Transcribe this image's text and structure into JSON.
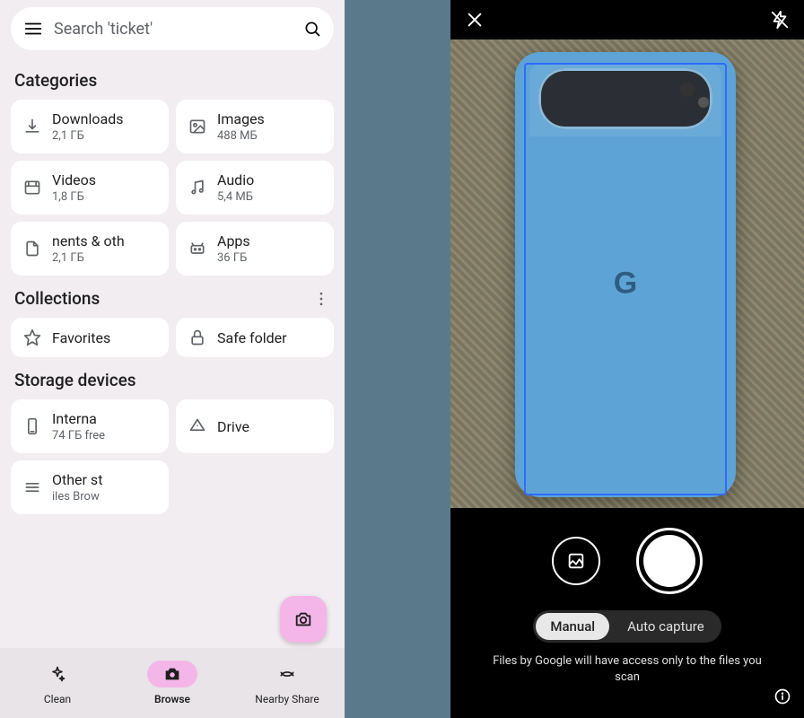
{
  "left": {
    "search": {
      "placeholder": "Search 'ticket'"
    },
    "sections": {
      "categories_title": "Categories",
      "collections_title": "Collections",
      "storage_title": "Storage devices"
    },
    "categories": [
      {
        "label": "Downloads",
        "sub": "2,1 ГБ",
        "icon": "download-icon"
      },
      {
        "label": "Images",
        "sub": "488 МБ",
        "icon": "image-icon"
      },
      {
        "label": "Videos",
        "sub": "1,8 ГБ",
        "icon": "film-icon"
      },
      {
        "label": "Audio",
        "sub": "5,4 МБ",
        "icon": "music-icon"
      },
      {
        "label": "nents & oth",
        "sub": "2,1 ГБ",
        "icon": "document-icon"
      },
      {
        "label": "Apps",
        "sub": "36 ГБ",
        "icon": "android-icon"
      }
    ],
    "collections": [
      {
        "label": "Favorites",
        "icon": "star-icon"
      },
      {
        "label": "Safe folder",
        "icon": "lock-icon"
      }
    ],
    "storage": [
      {
        "label": "Interna",
        "sub": "74 ГБ free",
        "icon": "phone-icon"
      },
      {
        "label": "Drive",
        "icon": "drive-icon"
      },
      {
        "label": "Other st",
        "sub": "iles    Brow",
        "icon": "list-icon"
      }
    ],
    "nav": {
      "clean": "Clean",
      "browse": "Browse",
      "nearby": "Nearby Share"
    }
  },
  "right": {
    "modes": {
      "manual": "Manual",
      "auto": "Auto capture",
      "active": "manual"
    },
    "disclaimer": "Files by Google will have access only to the files you scan"
  }
}
